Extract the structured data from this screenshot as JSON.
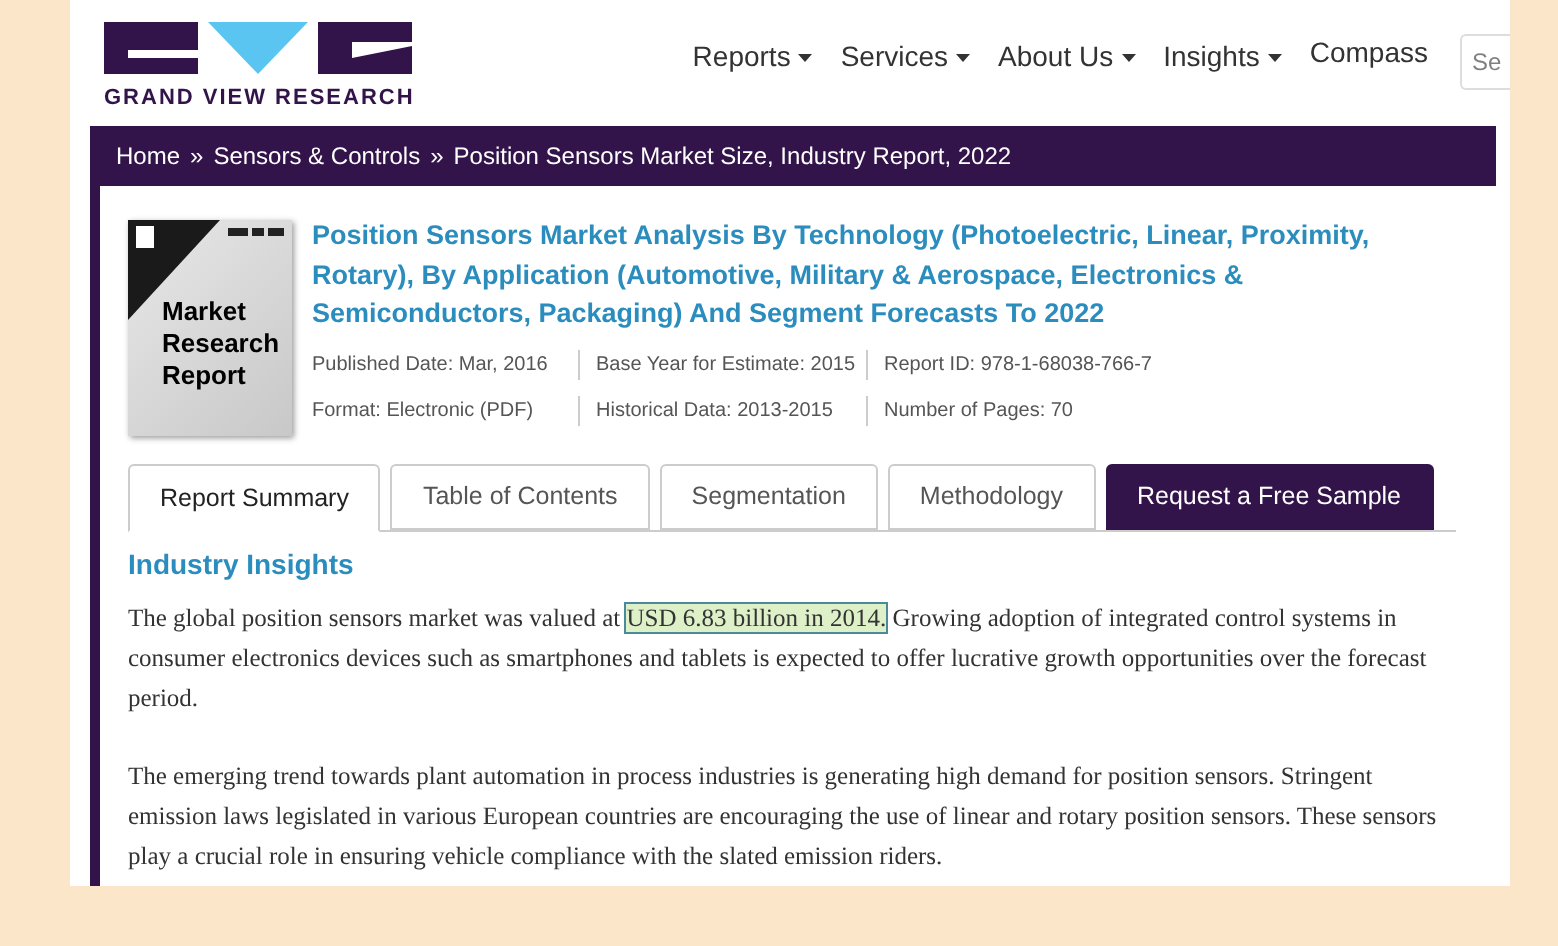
{
  "logo": {
    "wordmark": "GRAND VIEW RESEARCH"
  },
  "nav": [
    {
      "label": "Reports",
      "dropdown": true
    },
    {
      "label": "Services",
      "dropdown": true
    },
    {
      "label": "About Us",
      "dropdown": true
    },
    {
      "label": "Insights",
      "dropdown": true
    },
    {
      "label": "Compass",
      "dropdown": false
    }
  ],
  "search": {
    "placeholder": "Se"
  },
  "breadcrumb": [
    "Home",
    "Sensors & Controls",
    "Position Sensors Market Size, Industry Report, 2022"
  ],
  "breadcrumb_separator": "»",
  "report": {
    "cover_text": "Market Research Report",
    "title": "Position Sensors Market Analysis By Technology (Photoelectric, Linear, Proximity, Rotary), By Application (Automotive, Military & Aerospace, Electronics & Semiconductors, Packaging) And Segment Forecasts To 2022",
    "meta": [
      [
        "Published Date: Mar, 2016",
        "Base Year for Estimate: 2015",
        "Report ID: 978-1-68038-766-7"
      ],
      [
        "Format: Electronic (PDF)",
        "Historical Data: 2013-2015",
        "Number of Pages: 70"
      ]
    ]
  },
  "tabs": [
    {
      "label": "Report Summary",
      "selected": true,
      "kind": "tab"
    },
    {
      "label": "Table of Contents",
      "selected": false,
      "kind": "tab"
    },
    {
      "label": "Segmentation",
      "selected": false,
      "kind": "tab"
    },
    {
      "label": "Methodology",
      "selected": false,
      "kind": "tab"
    },
    {
      "label": "Request a Free Sample",
      "selected": false,
      "kind": "cta"
    }
  ],
  "section_heading": "Industry Insights",
  "paragraphs": [
    {
      "before": "The global position sensors market was valued at ",
      "highlight": "USD 6.83 billion in 2014.",
      "after": " Growing adoption of integrated control systems in consumer electronics devices such as smartphones and tablets is expected to offer lucrative growth opportunities over the forecast period."
    },
    {
      "before": "The emerging trend towards plant automation in process industries is generating high demand for position sensors. Stringent emission laws legislated in various European countries are encouraging the use of linear and rotary position sensors. These sensors play a crucial role in ensuring vehicle compliance with the slated emission riders."
    }
  ]
}
